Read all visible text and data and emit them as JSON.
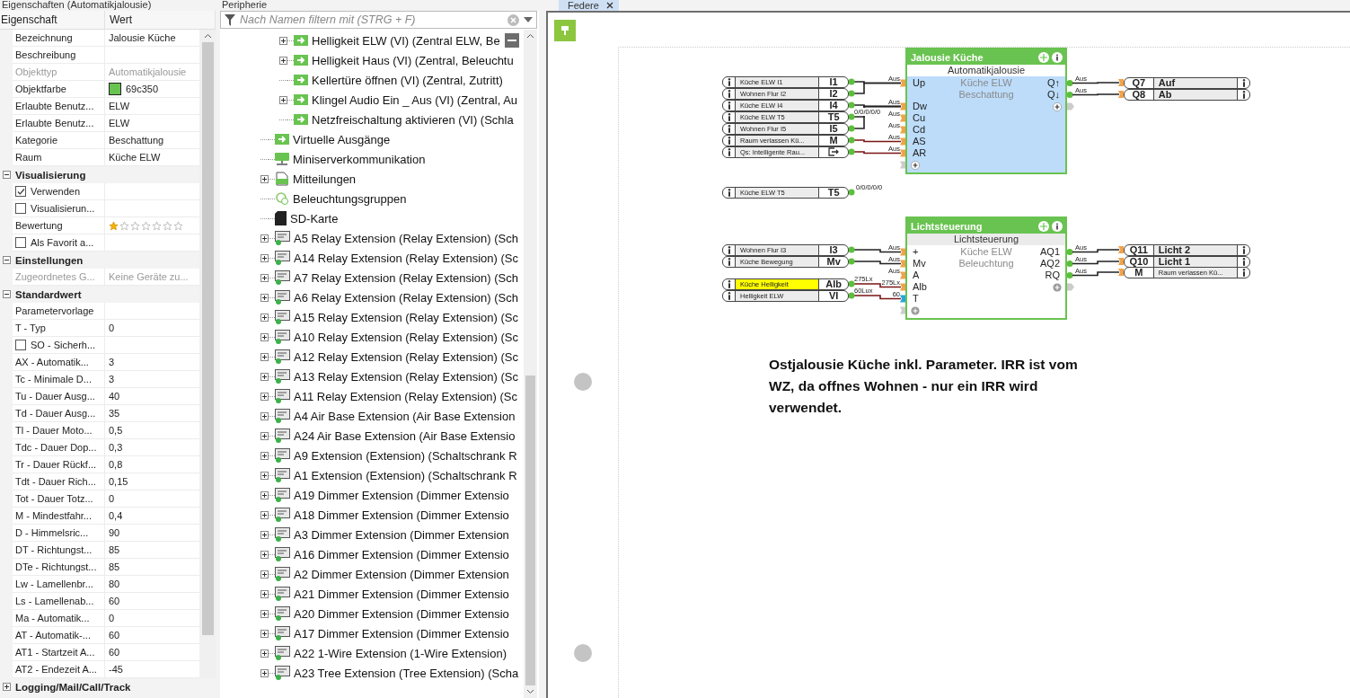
{
  "properties": {
    "title": "Eigenschaften (Automatikjalousie)",
    "columns": [
      "Eigenschaft",
      "Wert"
    ],
    "rows": [
      {
        "kind": "property",
        "label": "Bezeichnung",
        "value": "Jalousie Küche",
        "disabled": false
      },
      {
        "kind": "property",
        "label": "Beschreibung",
        "disabled": false
      },
      {
        "kind": "property",
        "label": "Objekttyp",
        "value": "Automatikjalousie",
        "disabled": true
      },
      {
        "kind": "color",
        "label": "Objektfarbe",
        "value": "69c350",
        "color": "#69c350"
      },
      {
        "kind": "property",
        "label": "Erlaubte Benutz...",
        "value": "ELW",
        "disabled": false
      },
      {
        "kind": "property",
        "label": "Erlaubte Benutz...",
        "value": "ELW",
        "disabled": false
      },
      {
        "kind": "property",
        "label": "Kategorie",
        "value": "Beschattung",
        "disabled": false
      },
      {
        "kind": "property",
        "label": "Raum",
        "value": "Küche ELW",
        "disabled": false
      },
      {
        "kind": "group",
        "label": "Visualisierung",
        "expanded": true
      },
      {
        "kind": "checkbox",
        "label": "Verwenden",
        "checked": true
      },
      {
        "kind": "checkbox",
        "label": "Visualisierun...",
        "checked": false
      },
      {
        "kind": "stars",
        "label": "Bewertung",
        "stars": 1
      },
      {
        "kind": "checkbox",
        "label": "Als Favorit a...",
        "checked": false
      },
      {
        "kind": "group",
        "label": "Einstellungen",
        "expanded": true
      },
      {
        "kind": "property",
        "label": "Zugeordnetes G...",
        "value": "Keine Geräte zu...",
        "disabled": true
      },
      {
        "kind": "group",
        "label": "Standardwert",
        "expanded": true
      },
      {
        "kind": "property",
        "label": "Parametervorlage",
        "disabled": false
      },
      {
        "kind": "property",
        "label": "T - Typ",
        "value": "0",
        "disabled": false
      },
      {
        "kind": "checkbox",
        "label": "SO - Sicherh...",
        "checked": false
      },
      {
        "kind": "property",
        "label": "AX - Automatik...",
        "value": "3",
        "disabled": false
      },
      {
        "kind": "property",
        "label": "Tc - Minimale D...",
        "value": "3",
        "disabled": false
      },
      {
        "kind": "property",
        "label": "Tu - Dauer Ausg...",
        "value": "40",
        "disabled": false
      },
      {
        "kind": "property",
        "label": "Td - Dauer Ausg...",
        "value": "35",
        "disabled": false
      },
      {
        "kind": "property",
        "label": "Tl - Dauer Moto...",
        "value": "0,5",
        "disabled": false
      },
      {
        "kind": "property",
        "label": "Tdc - Dauer Dop...",
        "value": "0,3",
        "disabled": false
      },
      {
        "kind": "property",
        "label": "Tr - Dauer Rückf...",
        "value": "0,8",
        "disabled": false
      },
      {
        "kind": "property",
        "label": "Tdt - Dauer Rich...",
        "value": "0,15",
        "disabled": false
      },
      {
        "kind": "property",
        "label": "Tot - Dauer Totz...",
        "value": "0",
        "disabled": false
      },
      {
        "kind": "property",
        "label": "M - Mindestfahr...",
        "value": "0,4",
        "disabled": false
      },
      {
        "kind": "property",
        "label": "D - Himmelsric...",
        "value": "90",
        "disabled": false
      },
      {
        "kind": "property",
        "label": "DT - Richtungst...",
        "value": "85",
        "disabled": false
      },
      {
        "kind": "property",
        "label": "DTe - Richtungst...",
        "value": "85",
        "disabled": false
      },
      {
        "kind": "property",
        "label": "Lw - Lamellenbr...",
        "value": "80",
        "disabled": false
      },
      {
        "kind": "property",
        "label": "Ls - Lamellenab...",
        "value": "60",
        "disabled": false
      },
      {
        "kind": "property",
        "label": "Ma - Automatik...",
        "value": "0",
        "disabled": false
      },
      {
        "kind": "property",
        "label": "AT - Automatik-...",
        "value": "60",
        "disabled": false
      },
      {
        "kind": "property",
        "label": "AT1 - Startzeit A...",
        "value": "60",
        "disabled": false
      },
      {
        "kind": "property",
        "label": "AT2 - Endezeit A...",
        "value": "-45",
        "disabled": false
      }
    ],
    "footer_group": {
      "label": "Logging/Mail/Call/Track",
      "expanded": false
    }
  },
  "periphery": {
    "title": "Peripherie",
    "search": {
      "placeholder": "Nach Namen filtern mit (STRG + F)"
    },
    "scrolled_branch_children": [
      {
        "label": "Helligkeit ELW (VI) (Zentral ELW, Be",
        "kind": "virtual-io",
        "expandable": true
      },
      {
        "label": "Helligkeit Haus (VI) (Zentral, Beleuchtu",
        "kind": "virtual-io",
        "expandable": true
      },
      {
        "label": "Kellertüre öffnen (VI) (Zentral, Zutritt)",
        "kind": "virtual-io",
        "expandable": false
      },
      {
        "label": "Klingel Audio Ein _ Aus (VI) (Zentral, Au",
        "kind": "virtual-io",
        "expandable": true
      },
      {
        "label": "Netzfreischaltung aktivieren (VI) (Schla",
        "kind": "virtual-io",
        "expandable": false
      }
    ],
    "items": [
      {
        "label": "Virtuelle Ausgänge",
        "kind": "virtual-io",
        "expandable": false
      },
      {
        "label": "Miniserverkommunikation",
        "kind": "network",
        "expandable": false
      },
      {
        "label": "Mitteilungen",
        "kind": "messages",
        "expandable": true
      },
      {
        "label": "Beleuchtungsgruppen",
        "kind": "lighting",
        "expandable": false
      },
      {
        "label": "SD-Karte",
        "kind": "sd-card",
        "expandable": false
      },
      {
        "label": "A5  Relay Extension (Relay Extension) (Sch",
        "kind": "extension",
        "expandable": true
      },
      {
        "label": "A14  Relay Extension (Relay Extension) (Sc",
        "kind": "extension",
        "expandable": true
      },
      {
        "label": "A7  Relay Extension (Relay Extension) (Sch",
        "kind": "extension",
        "expandable": true
      },
      {
        "label": "A6  Relay Extension (Relay Extension) (Sch",
        "kind": "extension",
        "expandable": true
      },
      {
        "label": "A15  Relay Extension (Relay Extension) (Sc",
        "kind": "extension",
        "expandable": true
      },
      {
        "label": "A10  Relay Extension (Relay Extension) (Sc",
        "kind": "extension",
        "expandable": true
      },
      {
        "label": "A12  Relay Extension (Relay Extension) (Sc",
        "kind": "extension",
        "expandable": true
      },
      {
        "label": "A13  Relay Extension (Relay Extension) (Sc",
        "kind": "extension",
        "expandable": true
      },
      {
        "label": "A11  Relay Extension (Relay Extension) (Sc",
        "kind": "extension",
        "expandable": true
      },
      {
        "label": "A4  Air Base Extension (Air Base Extension",
        "kind": "extension",
        "expandable": true
      },
      {
        "label": "A24  Air Base Extension (Air Base Extensio",
        "kind": "extension",
        "expandable": true
      },
      {
        "label": "A9  Extension (Extension) (Schaltschrank R",
        "kind": "extension",
        "expandable": true
      },
      {
        "label": "A1  Extension (Extension) (Schaltschrank R",
        "kind": "extension",
        "expandable": true
      },
      {
        "label": "A19  Dimmer Extension (Dimmer Extensio",
        "kind": "extension",
        "expandable": true
      },
      {
        "label": "A18  Dimmer Extension (Dimmer Extensio",
        "kind": "extension",
        "expandable": true
      },
      {
        "label": "A3  Dimmer Extension (Dimmer Extension",
        "kind": "extension",
        "expandable": true
      },
      {
        "label": "A16  Dimmer Extension (Dimmer Extensio",
        "kind": "extension",
        "expandable": true
      },
      {
        "label": "A2  Dimmer Extension (Dimmer Extension",
        "kind": "extension",
        "expandable": true
      },
      {
        "label": "A21  Dimmer Extension (Dimmer Extensio",
        "kind": "extension",
        "expandable": true
      },
      {
        "label": "A20  Dimmer Extension (Dimmer Extensio",
        "kind": "extension",
        "expandable": true
      },
      {
        "label": "A17  Dimmer Extension (Dimmer Extensio",
        "kind": "extension",
        "expandable": true
      },
      {
        "label": "A22  1-Wire Extension (1-Wire Extension)",
        "kind": "extension",
        "expandable": true
      },
      {
        "label": "A23  Tree Extension (Tree Extension) (Scha",
        "kind": "extension",
        "expandable": true
      }
    ]
  },
  "diagram": {
    "tabs": [
      {
        "label": "Federe",
        "selected": true
      }
    ],
    "blocks": [
      {
        "title": "Jalousie Küche",
        "type": "Automatikjalousie",
        "room": "Küche ELW",
        "category": "Beschattung",
        "selected": true,
        "inputs": [
          {
            "label": "Up",
            "wire": "Aus",
            "kind": "digital"
          },
          {
            "label": "Dw",
            "wire": "Aus",
            "kind": "digital"
          },
          {
            "label": "Cu",
            "wire": "Aus",
            "kind": "digital"
          },
          {
            "label": "Cd",
            "wire": "Aus",
            "kind": "digital"
          },
          {
            "label": "AS",
            "wire": "Aus",
            "kind": "analog"
          },
          {
            "label": "AR",
            "wire": "Aus",
            "kind": "analog"
          }
        ],
        "outputs": [
          {
            "label": "Q↑",
            "wire": "Aus"
          },
          {
            "label": "Q↓",
            "wire": "Aus"
          }
        ],
        "sources": [
          {
            "name": "Küche ELW I1",
            "id": "I1",
            "kind": "input",
            "highlighted": false
          },
          {
            "name": "Wohnen Flur I2",
            "id": "I2",
            "kind": "input",
            "highlighted": false
          },
          {
            "name": "Küche ELW I4",
            "id": "I4",
            "kind": "input",
            "highlighted": false
          },
          {
            "name": "Küche ELW T5",
            "id": "T5",
            "kind": "input",
            "highlighted": false,
            "value": "0/0/0/0/0"
          },
          {
            "name": "Wohnen Flur I5",
            "id": "I5",
            "kind": "input",
            "highlighted": false
          },
          {
            "name": "Raum  verlassen  Kü...",
            "id": "M",
            "kind": "input",
            "highlighted": false
          },
          {
            "name": "Qs:  Intelligente  Rau...",
            "kind": "virtual-output",
            "highlighted": false
          }
        ],
        "targets": [
          {
            "id": "Q7",
            "name": "Auf",
            "kind": "output"
          },
          {
            "id": "Q8",
            "name": "Ab",
            "kind": "output"
          }
        ]
      },
      {
        "title": "Lichtsteuerung",
        "type": "Lichtsteuerung",
        "room": "Küche ELW",
        "category": "Beleuchtung",
        "selected": false,
        "inputs": [
          {
            "label": "+",
            "wire": "Aus",
            "kind": "digital"
          },
          {
            "label": "Mv",
            "wire": "Aus",
            "kind": "digital"
          },
          {
            "label": "A",
            "wire": "Aus",
            "kind": "digital"
          },
          {
            "label": "Alb",
            "wire": "275Lx",
            "kind": "analog"
          },
          {
            "label": "T",
            "wire": "60",
            "kind": "parameter"
          }
        ],
        "outputs": [
          {
            "label": "AQ1",
            "wire": "Aus"
          },
          {
            "label": "AQ2",
            "wire": "Aus"
          },
          {
            "label": "RQ",
            "wire": "Aus"
          }
        ],
        "sources": [
          {
            "name": "Wohnen Flur I3",
            "id": "I3",
            "kind": "input",
            "highlighted": false
          },
          {
            "name": "Küche Bewegung",
            "id": "Mv",
            "kind": "input",
            "highlighted": false
          },
          {
            "name": "Küche Helligkeit",
            "id": "Alb",
            "kind": "input",
            "highlighted": true,
            "value": "275Lx"
          },
          {
            "name": "Helligkeit ELW",
            "id": "VI",
            "kind": "input",
            "highlighted": false,
            "value": "60Lux"
          }
        ],
        "targets": [
          {
            "id": "Q11",
            "name": "Licht 2",
            "kind": "output"
          },
          {
            "id": "Q10",
            "name": "Licht 1",
            "kind": "output"
          },
          {
            "id": "M",
            "name": "Raum  verlassen  Kü...",
            "kind": "flag"
          }
        ]
      }
    ],
    "loose_sources": [
      {
        "name": "Küche ELW T5",
        "id": "T5",
        "kind": "input",
        "highlighted": false,
        "value": "0/0/0/0/0"
      }
    ],
    "note": "Ostjalousie Küche inkl. Parameter. IRR ist vom WZ, da offnes Wohnen - nur ein IRR wird verwendet."
  }
}
